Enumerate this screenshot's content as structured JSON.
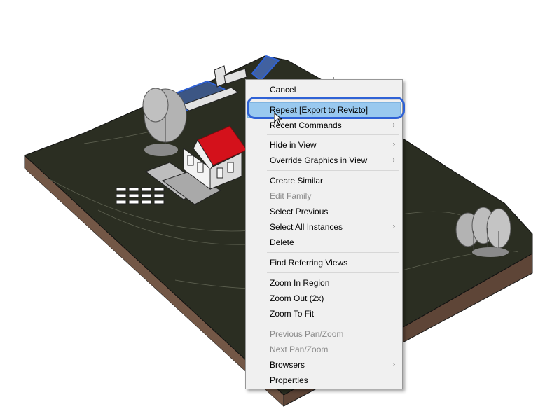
{
  "context_menu": {
    "items": [
      {
        "label": "Cancel",
        "enabled": true,
        "submenu": false
      },
      {
        "label": "Repeat [Export to Revizto]",
        "enabled": true,
        "submenu": false,
        "highlighted": true
      },
      {
        "label": "Recent Commands",
        "enabled": true,
        "submenu": true
      },
      {
        "label": "Hide in View",
        "enabled": true,
        "submenu": true
      },
      {
        "label": "Override Graphics in View",
        "enabled": true,
        "submenu": true
      },
      {
        "label": "Create Similar",
        "enabled": true,
        "submenu": false
      },
      {
        "label": "Edit Family",
        "enabled": false,
        "submenu": false
      },
      {
        "label": "Select Previous",
        "enabled": true,
        "submenu": false
      },
      {
        "label": "Select All Instances",
        "enabled": true,
        "submenu": true
      },
      {
        "label": "Delete",
        "enabled": true,
        "submenu": false
      },
      {
        "label": "Find Referring Views",
        "enabled": true,
        "submenu": false
      },
      {
        "label": "Zoom In Region",
        "enabled": true,
        "submenu": false
      },
      {
        "label": "Zoom Out (2x)",
        "enabled": true,
        "submenu": false
      },
      {
        "label": "Zoom To Fit",
        "enabled": true,
        "submenu": false
      },
      {
        "label": "Previous Pan/Zoom",
        "enabled": false,
        "submenu": false
      },
      {
        "label": "Next Pan/Zoom",
        "enabled": false,
        "submenu": false
      },
      {
        "label": "Browsers",
        "enabled": true,
        "submenu": true
      },
      {
        "label": "Properties",
        "enabled": true,
        "submenu": false
      }
    ],
    "submenu_glyph": "›"
  },
  "colors": {
    "terrain_top": "#2a2d21",
    "terrain_side": "#6e5344",
    "roof": "#d4111b",
    "selection": "#3b6fd4",
    "menu_highlight": "#99c9ef"
  }
}
